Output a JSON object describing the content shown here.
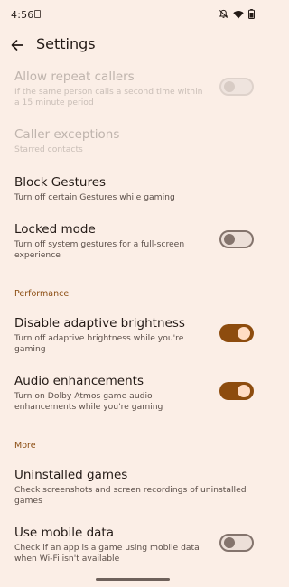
{
  "status": {
    "time": "4:56"
  },
  "appbar": {
    "title": "Settings"
  },
  "items": {
    "allow_repeat": {
      "title": "Allow repeat callers",
      "subtitle": "If the same person calls a second time within a 15 minute period"
    },
    "caller_exceptions": {
      "title": "Caller exceptions",
      "subtitle": "Starred contacts"
    },
    "block_gestures": {
      "title": "Block Gestures",
      "subtitle": "Turn off certain Gestures while gaming"
    },
    "locked_mode": {
      "title": "Locked mode",
      "subtitle": "Turn off system gestures for a full-screen experience"
    },
    "adaptive_brightness": {
      "title": "Disable adaptive brightness",
      "subtitle": "Turn off adaptive brightness while you're gaming"
    },
    "audio_enhancements": {
      "title": "Audio enhancements",
      "subtitle": "Turn on Dolby Atmos game audio enhancements while you're gaming"
    },
    "uninstalled_games": {
      "title": "Uninstalled games",
      "subtitle": "Check screenshots and screen recordings of uninstalled games"
    },
    "mobile_data": {
      "title": "Use mobile data",
      "subtitle": "Check if an app is a game using mobile data when Wi-Fi isn't available"
    }
  },
  "sections": {
    "performance": "Performance",
    "more": "More"
  },
  "toggles": {
    "allow_repeat": false,
    "locked_mode": false,
    "adaptive_brightness": true,
    "audio_enhancements": true,
    "mobile_data": false
  },
  "colors": {
    "background": "#fbeee6",
    "accent": "#8d4c0e",
    "section_header": "#8b4d12"
  }
}
